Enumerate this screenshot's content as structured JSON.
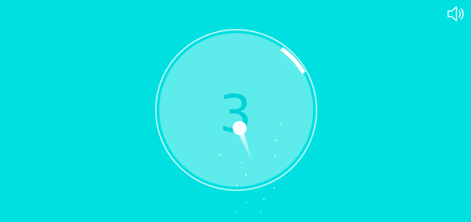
{
  "game": {
    "counter": "3",
    "arc_progress_fraction": 0.08,
    "colors": {
      "background": "#00E0E0",
      "board_fill": "#5EEBEB",
      "board_ring": "#BFF7F7",
      "counter_text": "#00D2D8",
      "ball": "#FFFFFF"
    }
  },
  "controls": {
    "sound_icon": "speaker-icon"
  }
}
